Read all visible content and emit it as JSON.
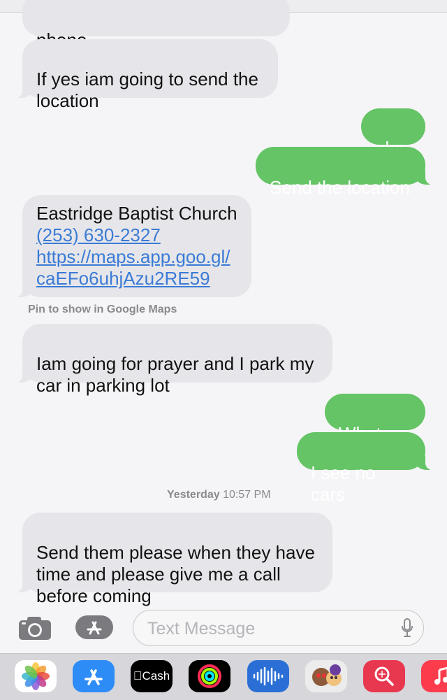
{
  "messages": [
    {
      "text": "phone"
    },
    {
      "text": "If yes iam going to send the\nlocation"
    },
    {
      "text": "okay"
    },
    {
      "text": "Send the location"
    },
    {
      "title": "Eastridge Baptist Church",
      "phone": "(253) 630-2327",
      "url": "https://maps.app.goo.gl/\ncaEFo6uhjAzu2RE59"
    },
    {
      "text": "Iam going for prayer and I park my\ncar in parking lot"
    },
    {
      "text": "What car"
    },
    {
      "text": "I see no cars"
    },
    {
      "text": "Send them please when they have\ntime and please give me a call\nbefore coming"
    }
  ],
  "pin_note": "Pin to show in Google Maps",
  "timestamp": {
    "day": "Yesterday",
    "time": "10:57 PM"
  },
  "composer": {
    "placeholder": "Text Message"
  },
  "dock": {
    "apps": [
      "photos-icon",
      "app-store-icon",
      "cash-icon",
      "fitness-icon",
      "voice-memos-icon",
      "memoji-icon",
      "search-icon",
      "music-icon"
    ],
    "cash_label": "Cash"
  },
  "colors": {
    "incoming": "#e6e6ea",
    "outgoing": "#65c466",
    "link": "#3a7bd5"
  }
}
